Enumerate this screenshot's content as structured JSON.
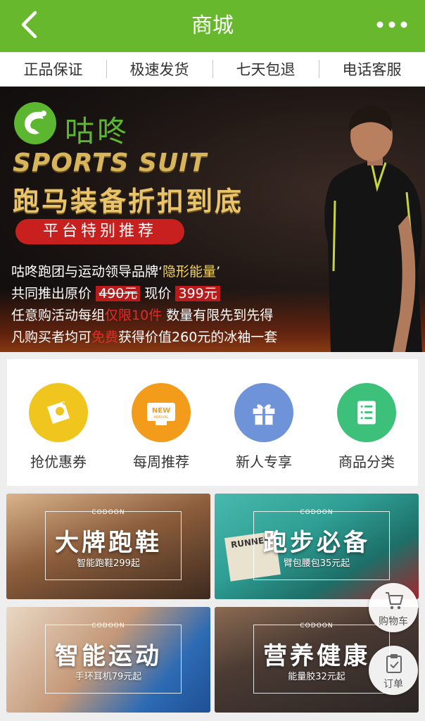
{
  "header": {
    "title": "商城",
    "back_icon": "chevron-left-icon",
    "more_icon": "more-dots-icon",
    "bg_color": "#68b82e"
  },
  "guarantee": [
    "正品保证",
    "极速发货",
    "七天包退",
    "电话客服"
  ],
  "banner": {
    "brand": "咕咚",
    "english_title": "SPORTS SUIT",
    "headline": "跑马装备折扣到底",
    "badge": "平台特别推荐",
    "lines": {
      "l1_a": "咕咚跑团与运动领导品牌‘",
      "l1_b": "隐形能量",
      "l1_c": "’",
      "l2_a": "共同推出原价",
      "l2_orig": "490元",
      "l2_b": "现价",
      "l2_now": "399元",
      "l3_a": "任意购活动每组",
      "l3_b": "仅限10件",
      "l3_c": "数量有限先到先得",
      "l4_a": "凡购买者均可",
      "l4_b": "免费",
      "l4_c": "获得价值260元的冰袖一套"
    }
  },
  "quick_links": [
    {
      "label": "抢优惠券",
      "icon": "coupon-icon",
      "color": "#f0c51d"
    },
    {
      "label": "每周推荐",
      "icon": "new-arrival-icon",
      "color": "#f39c1c",
      "icon_text_1": "NEW",
      "icon_text_2": "ARRIVAL"
    },
    {
      "label": "新人专享",
      "icon": "gift-icon",
      "color": "#6f93d8"
    },
    {
      "label": "商品分类",
      "icon": "list-icon",
      "color": "#3cc07a"
    }
  ],
  "tiles": [
    {
      "title": "大牌跑鞋",
      "subtitle": "智能跑鞋299起",
      "brand": "CODOON"
    },
    {
      "title": "跑步必备",
      "subtitle": "臂包腰包35元起",
      "brand": "CODOON",
      "bib": "RUNNER"
    },
    {
      "title": "智能运动",
      "subtitle": "手环耳机79元起",
      "brand": "CODOON"
    },
    {
      "title": "营养健康",
      "subtitle": "能量胶32元起",
      "brand": "CODOON"
    }
  ],
  "floating": {
    "cart_label": "购物车",
    "cart_icon": "cart-icon",
    "order_label": "订单",
    "order_icon": "clipboard-icon"
  }
}
